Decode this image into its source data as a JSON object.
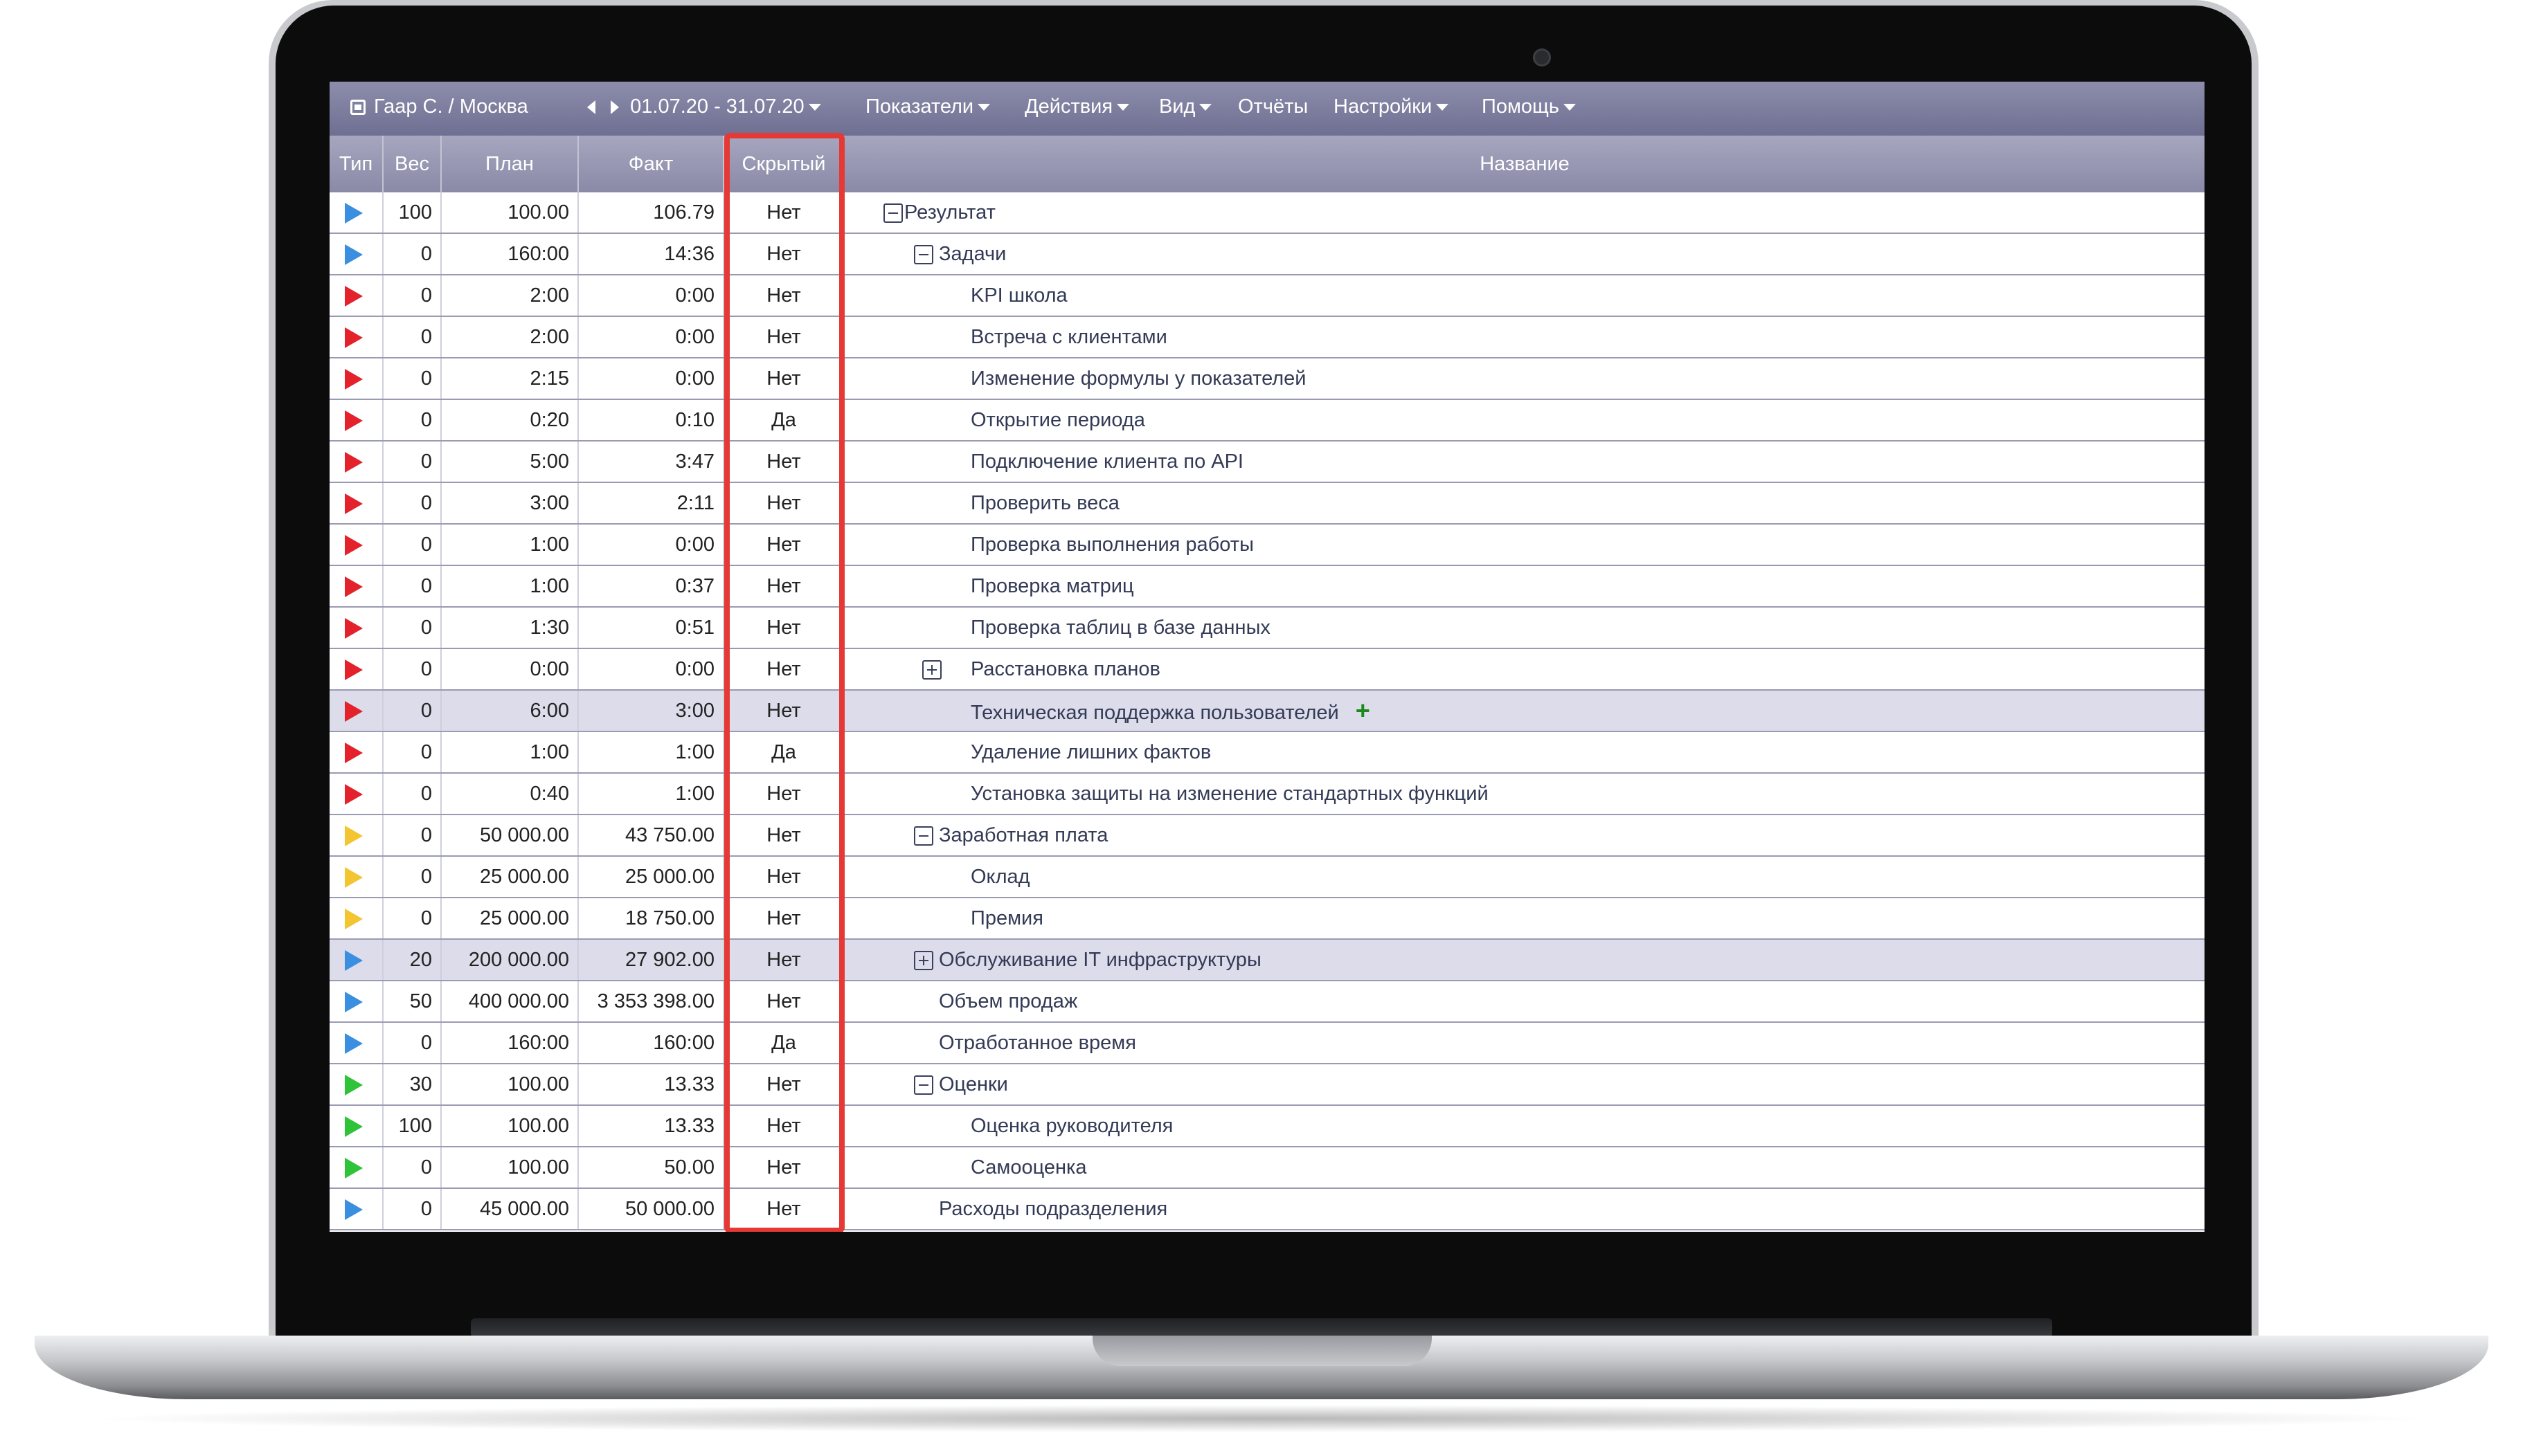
{
  "toolbar": {
    "user": "Гаар С. / Москва",
    "period": "01.07.20 - 31.07.20",
    "menu": [
      "Показатели",
      "Действия",
      "Вид",
      "Отчёты",
      "Настройки",
      "Помощь"
    ]
  },
  "columns": {
    "type": "Тип",
    "weight": "Вес",
    "plan": "План",
    "fact": "Факт",
    "hidden": "Скрытый",
    "name": "Название"
  },
  "rows": [
    {
      "type": "blue",
      "weight": "100",
      "plan": "100.00",
      "fact": "106.79",
      "hidden": "Нет",
      "name": "Результат",
      "toggle": "minus",
      "level": 0
    },
    {
      "type": "blue",
      "weight": "0",
      "plan": "160:00",
      "fact": "14:36",
      "hidden": "Нет",
      "name": "Задачи",
      "toggle": "minus",
      "level": 1
    },
    {
      "type": "red",
      "weight": "0",
      "plan": "2:00",
      "fact": "0:00",
      "hidden": "Нет",
      "name": "KPI школа",
      "toggle": "",
      "level": 2
    },
    {
      "type": "red",
      "weight": "0",
      "plan": "2:00",
      "fact": "0:00",
      "hidden": "Нет",
      "name": "Встреча с клиентами",
      "toggle": "",
      "level": 2
    },
    {
      "type": "red",
      "weight": "0",
      "plan": "2:15",
      "fact": "0:00",
      "hidden": "Нет",
      "name": "Изменение формулы у показателей",
      "toggle": "",
      "level": 2
    },
    {
      "type": "red",
      "weight": "0",
      "plan": "0:20",
      "fact": "0:10",
      "hidden": "Да",
      "name": "Открытие периода",
      "toggle": "",
      "level": 2
    },
    {
      "type": "red",
      "weight": "0",
      "plan": "5:00",
      "fact": "3:47",
      "hidden": "Нет",
      "name": "Подключение клиента по API",
      "toggle": "",
      "level": 2
    },
    {
      "type": "red",
      "weight": "0",
      "plan": "3:00",
      "fact": "2:11",
      "hidden": "Нет",
      "name": "Проверить веса",
      "toggle": "",
      "level": 2
    },
    {
      "type": "red",
      "weight": "0",
      "plan": "1:00",
      "fact": "0:00",
      "hidden": "Нет",
      "name": "Проверка выполнения работы",
      "toggle": "",
      "level": 2
    },
    {
      "type": "red",
      "weight": "0",
      "plan": "1:00",
      "fact": "0:37",
      "hidden": "Нет",
      "name": "Проверка матриц",
      "toggle": "",
      "level": 2
    },
    {
      "type": "red",
      "weight": "0",
      "plan": "1:30",
      "fact": "0:51",
      "hidden": "Нет",
      "name": "Проверка таблиц в базе данных",
      "toggle": "",
      "level": 2
    },
    {
      "type": "red",
      "weight": "0",
      "plan": "0:00",
      "fact": "0:00",
      "hidden": "Нет",
      "name": "Расстановка планов",
      "toggle": "plus",
      "level": 2
    },
    {
      "type": "red",
      "weight": "0",
      "plan": "6:00",
      "fact": "3:00",
      "hidden": "Нет",
      "name": "Техническая поддержка пользователей",
      "toggle": "",
      "level": 2,
      "selected": true,
      "add": true
    },
    {
      "type": "red",
      "weight": "0",
      "plan": "1:00",
      "fact": "1:00",
      "hidden": "Да",
      "name": "Удаление лишних фактов",
      "toggle": "",
      "level": 2
    },
    {
      "type": "red",
      "weight": "0",
      "plan": "0:40",
      "fact": "1:00",
      "hidden": "Нет",
      "name": "Установка защиты на изменение стандартных функций",
      "toggle": "",
      "level": 2
    },
    {
      "type": "yellow",
      "weight": "0",
      "plan": "50 000.00",
      "fact": "43 750.00",
      "hidden": "Нет",
      "name": "Заработная плата",
      "toggle": "minus",
      "level": 1
    },
    {
      "type": "yellow",
      "weight": "0",
      "plan": "25 000.00",
      "fact": "25 000.00",
      "hidden": "Нет",
      "name": "Оклад",
      "toggle": "",
      "level": 2
    },
    {
      "type": "yellow",
      "weight": "0",
      "plan": "25 000.00",
      "fact": "18 750.00",
      "hidden": "Нет",
      "name": "Премия",
      "toggle": "",
      "level": 2
    },
    {
      "type": "blue",
      "weight": "20",
      "plan": "200 000.00",
      "fact": "27 902.00",
      "hidden": "Нет",
      "name": "Обслуживание IT инфраструктуры",
      "toggle": "plus",
      "level": 1,
      "selected": true
    },
    {
      "type": "blue",
      "weight": "50",
      "plan": "400 000.00",
      "fact": "3 353 398.00",
      "hidden": "Нет",
      "name": "Объем продаж",
      "toggle": "",
      "level": 1
    },
    {
      "type": "blue",
      "weight": "0",
      "plan": "160:00",
      "fact": "160:00",
      "hidden": "Да",
      "name": "Отработанное время",
      "toggle": "",
      "level": 1
    },
    {
      "type": "green",
      "weight": "30",
      "plan": "100.00",
      "fact": "13.33",
      "hidden": "Нет",
      "name": "Оценки",
      "toggle": "minus",
      "level": 1
    },
    {
      "type": "green",
      "weight": "100",
      "plan": "100.00",
      "fact": "13.33",
      "hidden": "Нет",
      "name": "Оценка руководителя",
      "toggle": "",
      "level": 2
    },
    {
      "type": "green",
      "weight": "0",
      "plan": "100.00",
      "fact": "50.00",
      "hidden": "Нет",
      "name": "Самооценка",
      "toggle": "",
      "level": 2
    },
    {
      "type": "blue",
      "weight": "0",
      "plan": "45 000.00",
      "fact": "50 000.00",
      "hidden": "Нет",
      "name": "Расходы подразделения",
      "toggle": "",
      "level": 1
    }
  ]
}
